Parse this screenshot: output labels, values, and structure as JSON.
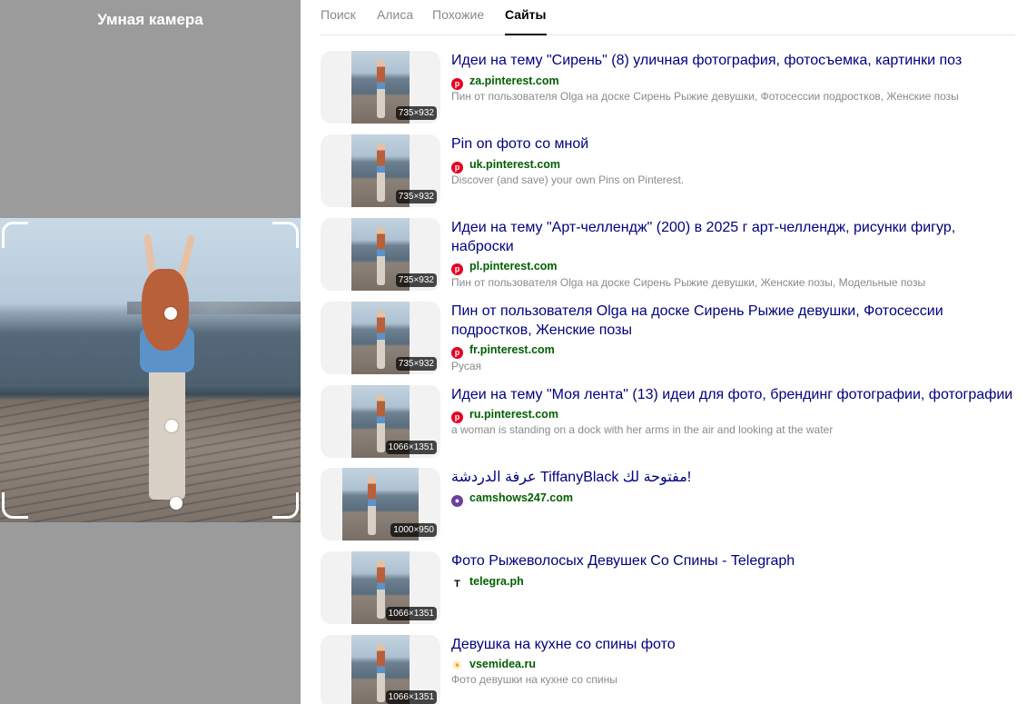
{
  "left_panel": {
    "title": "Умная камера"
  },
  "tabs": [
    {
      "label": "Поиск",
      "active": false
    },
    {
      "label": "Алиса",
      "active": false
    },
    {
      "label": "Похожие",
      "active": false
    },
    {
      "label": "Сайты",
      "active": true
    }
  ],
  "results": [
    {
      "title": "Идеи на тему \"Сирень\" (8) уличная фотография, фотосъемка, картинки поз",
      "site": "za.pinterest.com",
      "favicon": "pinterest-icon",
      "desc": "Пин от пользователя Olga на доске Сирень Рыжие девушки, Фотосессии подростков, Женские позы",
      "size": "735×932"
    },
    {
      "title": "Pin on фото со мной",
      "site": "uk.pinterest.com",
      "favicon": "pinterest-icon",
      "desc": "Discover (and save) your own Pins on Pinterest.",
      "size": "735×932"
    },
    {
      "title": "Идеи на тему \"Арт-челлендж\" (200) в 2025 г арт-челлендж, рисунки фигур, наброски",
      "site": "pl.pinterest.com",
      "favicon": "pinterest-icon",
      "desc": "Пин от пользователя Olga на доске Сирень Рыжие девушки, Женские позы, Модельные позы",
      "size": "735×932"
    },
    {
      "title": "Пин от пользователя Olga на доске Сирень Рыжие девушки, Фотосессии подростков, Женские позы",
      "site": "fr.pinterest.com",
      "favicon": "pinterest-icon",
      "desc": "Русая",
      "size": "735×932"
    },
    {
      "title": "Идеи на тему \"Моя лента\" (13) идеи для фото, брендинг фотографии, фотографии",
      "site": "ru.pinterest.com",
      "favicon": "pinterest-icon",
      "desc": "a woman is standing on a dock with her arms in the air and looking at the water",
      "size": "1066×1351"
    },
    {
      "title": "عرفة الدردشة TiffanyBlack مفتوحة لك!",
      "site": "camshows247.com",
      "favicon": "camshows-icon",
      "desc": "",
      "size": "1000×950"
    },
    {
      "title": "Фото Рыжеволосых Девушек Со Спины - Telegraph",
      "site": "telegra.ph",
      "favicon": "telegraph-icon",
      "desc": "",
      "size": "1066×1351"
    },
    {
      "title": "Девушка на кухне со спины фото",
      "site": "vsemidea.ru",
      "favicon": "sun-icon",
      "desc": "Фото девушки на кухне со спины",
      "size": "1066×1351"
    }
  ]
}
